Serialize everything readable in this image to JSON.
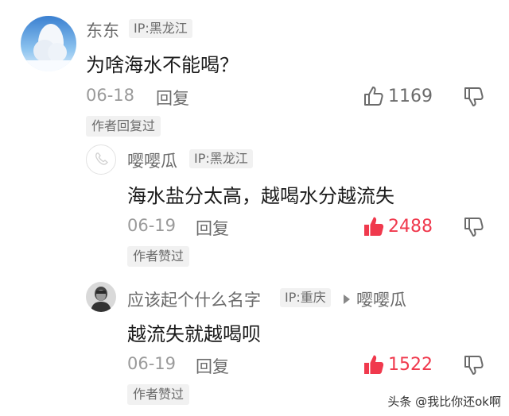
{
  "comments": [
    {
      "user": "东东",
      "ip": "IP:黑龙江",
      "text": "为啥海水不能喝？",
      "date": "06-18",
      "reply_label": "回复",
      "likes": "1169",
      "liked": false,
      "author_tag": "作者回复过"
    },
    {
      "user": "嘤嘤瓜",
      "ip": "IP:黑龙江",
      "text": "海水盐分太高，越喝水分越流失",
      "date": "06-19",
      "reply_label": "回复",
      "likes": "2488",
      "liked": true,
      "author_tag": "作者赞过"
    },
    {
      "user": "应该起个什么名字",
      "ip": "IP:重庆",
      "reply_to": "嘤嘤瓜",
      "text": "越流失就越喝呗",
      "date": "06-19",
      "reply_label": "回复",
      "likes": "1522",
      "liked": true,
      "author_tag": "作者赞过"
    }
  ],
  "watermark": "头条 @我比你还ok啊",
  "colors": {
    "liked": "#f0394d",
    "muted": "#6b6b6b",
    "text": "#1a1a1a",
    "badge_bg": "#f1f1f1"
  },
  "icons": {
    "like": "thumbs-up-icon",
    "dislike": "thumbs-down-icon",
    "reply_arrow": "triangle-right-icon"
  }
}
